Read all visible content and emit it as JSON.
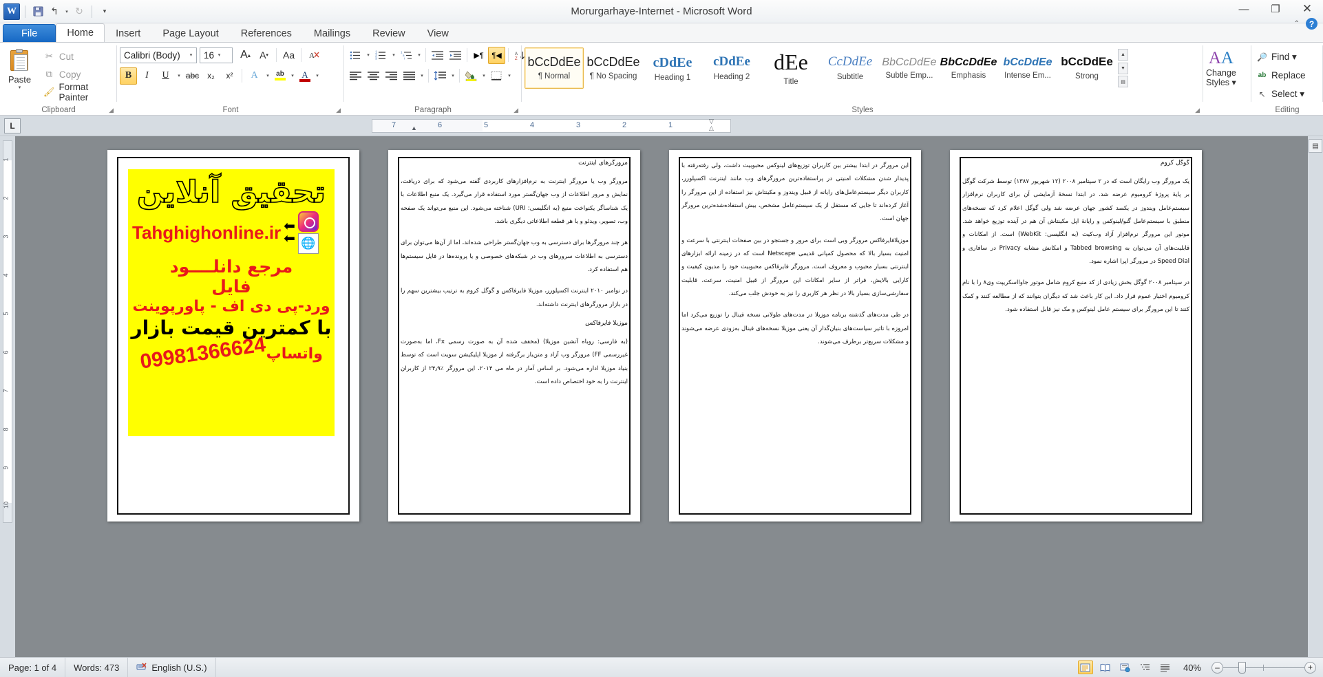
{
  "window": {
    "title": "Morurgarhaye-Internet  -  Microsoft Word",
    "minimize": "—",
    "restore": "❐",
    "close": "✕",
    "help": "?",
    "collapse_ribbon": "⌃"
  },
  "qat": {
    "logo": "W",
    "save": "save-icon",
    "undo": "↰",
    "redo": "↻",
    "customize": "▾"
  },
  "tabs": [
    {
      "label": "File",
      "active": false,
      "file": true
    },
    {
      "label": "Home",
      "active": true
    },
    {
      "label": "Insert",
      "active": false
    },
    {
      "label": "Page Layout",
      "active": false
    },
    {
      "label": "References",
      "active": false
    },
    {
      "label": "Mailings",
      "active": false
    },
    {
      "label": "Review",
      "active": false
    },
    {
      "label": "View",
      "active": false
    }
  ],
  "ribbon": {
    "clipboard": {
      "group_label": "Clipboard",
      "paste": "Paste",
      "paste_arrow": "▾",
      "items": [
        {
          "label": "Cut",
          "icon": "scissors-icon",
          "glyph": "✂",
          "enabled": false
        },
        {
          "label": "Copy",
          "icon": "copy-icon",
          "glyph": "⧉",
          "enabled": false
        },
        {
          "label": "Format Painter",
          "icon": "brush-icon",
          "glyph": "🖌",
          "enabled": true
        }
      ]
    },
    "font": {
      "group_label": "Font",
      "font_name": "Calibri (Body)",
      "font_size": "16",
      "grow_font": "A",
      "shrink_font": "A",
      "change_case": "Aa",
      "clear_formatting": "⌫",
      "bold": "B",
      "bold_active": true,
      "italic": "I",
      "underline": "U",
      "strikethrough": "abc",
      "subscript": "x₂",
      "superscript": "x²",
      "text_effects": "A",
      "highlight": "ab",
      "font_color": "A",
      "highlight_color": "#ffff00",
      "font_color_value": "#c00000"
    },
    "paragraph": {
      "group_label": "Paragraph",
      "bullets": "≔",
      "numbering": "≕",
      "multilevel": "≖",
      "decrease_indent": "⇤",
      "increase_indent": "⇥",
      "ltr_text": "▶¶",
      "rtl_text": "¶◀",
      "rtl_active": true,
      "sort": "A↓",
      "show_marks": "¶",
      "align_left": "≡",
      "align_center": "≡",
      "align_right": "≡",
      "justify": "≡",
      "line_spacing": "↕≡",
      "shading": "▱",
      "borders": "⊞"
    },
    "styles": {
      "group_label": "Styles",
      "items": [
        {
          "preview": "bCcDdEe",
          "name": "¶ Normal",
          "selected": true,
          "style": "normal"
        },
        {
          "preview": "bCcDdEe",
          "name": "¶ No Spacing",
          "selected": false,
          "style": "normal"
        },
        {
          "preview": "cDdEe",
          "name": "Heading 1",
          "selected": false,
          "style": "h1"
        },
        {
          "preview": "cDdEe",
          "name": "Heading 2",
          "selected": false,
          "style": "h2"
        },
        {
          "preview": "dEe",
          "name": "Title",
          "selected": false,
          "style": "title"
        },
        {
          "preview": "CcDdEe",
          "name": "Subtitle",
          "selected": false,
          "style": "subtitle"
        },
        {
          "preview": "BbCcDdEe",
          "name": "Subtle Emp...",
          "selected": false,
          "style": "subtle"
        },
        {
          "preview": "BbCcDdEe",
          "name": "Emphasis",
          "selected": false,
          "style": "emphasis"
        },
        {
          "preview": "bCcDdEe",
          "name": "Intense Em...",
          "selected": false,
          "style": "intense"
        },
        {
          "preview": "bCcDdEe",
          "name": "Strong",
          "selected": false,
          "style": "strong"
        }
      ],
      "scroll_up": "▲",
      "scroll_down": "▼",
      "more": "▤"
    },
    "change_styles": {
      "group_label": "",
      "icon": "AA",
      "label_line1": "Change",
      "label_line2": "Styles ▾"
    },
    "editing": {
      "group_label": "Editing",
      "items": [
        {
          "label": "Find ▾",
          "icon": "binoculars-icon",
          "glyph": "🔍"
        },
        {
          "label": "Replace",
          "icon": "replace-icon",
          "glyph": "ab"
        },
        {
          "label": "Select ▾",
          "icon": "pointer-icon",
          "glyph": "↖"
        }
      ]
    }
  },
  "ruler": {
    "tab_selector": "L",
    "h_numbers": [
      "7",
      "6",
      "5",
      "4",
      "3",
      "2",
      "1"
    ],
    "v_numbers": [
      "1",
      "2",
      "3",
      "4",
      "5",
      "6",
      "7",
      "8",
      "9",
      "10"
    ]
  },
  "document": {
    "pages": [
      {
        "kind": "ad",
        "ad": {
          "title": "تحقیق آنلاین",
          "url": "Tahghighonline.ir",
          "arrow": "⬅",
          "instagram_icon": "instagram-icon",
          "globe_icon": "globe-icon",
          "line1": "مرجع دانلــــود",
          "line2": "فایل",
          "line3": "ورد-پی دی اف - پاورپوینت",
          "line4": "با کمترین قیمت بازار",
          "phone": "09981366624",
          "whatsapp": "واتساپ"
        }
      },
      {
        "kind": "text",
        "heading": "مرورگرهای اینترنت",
        "paragraphs": [
          "مرورگر وب یا مرورگر اینترنت به نرم‌افزارهای کاربردی گفته می‌شود که برای دریافت، نمایش و مرور اطلاعات از وب جهان‌گستر مورد استفاده قرار می‌گیرد. یک منبع اطلاعات با یک شناساگر یکنواخت منبع (به انگلیسی: URI) شناخته می‌شود. این منبع می‌تواند یک صفحه وب، تصویر، ویدئو و یا هر قطعه اطلاعاتی دیگری باشد.",
          "هر چند مرورگرها برای دسترسی به وب جهان‌گستر طراحی شده‌اند، اما از آن‌ها می‌توان برای دسترسی به اطلاعات سرورهای وب در شبکه‌های خصوصی و یا پرونده‌ها در فایل سیستم‌ها هم استفاده کرد.",
          "در نوامبر ۲۰۱۰ اینترنت اکسپلورر، موزیلا فایرفاکس و گوگل کروم به ترتیب بیشترین سهم را در بازار مرورگرهای اینترنت داشته‌اند."
        ],
        "subheading": "موزیلا فایرفاکس",
        "paragraphs2": [
          "(به فارسی: روباه آتشین موزیلا) (مخفف شده آن به صورت رسمی Fx، اما به‌صورت غیررسمی FF) مرورگر وب آزاد و متن‌باز برگرفته از موزیلا اپلیکیشن سویت است که توسط بنیاد موزیلا اداره می‌شود. بر اساس آمار در ماه می ۲۰۱۴، این مرورگر ٪۲۴٫۹ از کاربران اینترنت را به خود اختصاص داده است."
        ]
      },
      {
        "kind": "text",
        "heading": "",
        "paragraphs": [
          "این مرورگر در ابتدا بیشتر بین کاربران توزیع‌های لینوکس محبوبیت داشت، ولی رفته‌رفته با پدیدار شدن مشکلات امنیتی در پراستفاده‌ترین مرورگرهای وب مانند اینترنت اکسپلورر، کاربران دیگر سیستم‌عامل‌های رایانه از قبیل ویندوز و مکینتاش نیز استفاده از این مرورگر را آغاز کرده‌اند تا جایی که مستقل از یک سیستم‌عامل مشخص، بیش استفاده‌شده‌ترین مرورگر جهان است.",
          "موزیلافایرفاکس مرورگر وبی است برای مرور و جستجو در بین صفحات اینترنتی با سرعت و امنیت بسیار بالا که محصول کمپانی قدیمی Netscape است که در زمینه ارائه ابزارهای اینترنتی بسیار محبوب و معروف است. مرورگر فایرفاکس محبوبیت خود را مدیون کیفیت و کارایی بالایش، فراتر از سایر امکانات این مرورگر از قبیل امنیت، سرعت، قابلیت سفارشی‌سازی بسیار بالا در نظر هر کاربری را نیز به خودش جلب می‌کند.",
          "در طی مدت‌های گذشته برنامه موزیلا در مدت‌های طولانی نسخه فینال را توزیع می‌کرد اما امروزه با تاثیر سیاست‌های بنیان‌گذار آن یعنی موزیلا نسخه‌های فینال به‌زودی عرضه می‌شوند و مشکلات سریع‌تر برطرف می‌شوند."
        ],
        "subheading": "",
        "paragraphs2": []
      },
      {
        "kind": "text",
        "heading": "گوگل کروم",
        "paragraphs": [
          "یک مرورگر وب رایگان است که در ۲ سپتامبر ۲۰۰۸ (۱۲ شهریور ۱۳۸۷) توسط شرکت گوگل بر پایهٔ پروژهٔ کرومیوم عرضه شد. در ابتدا نسخهٔ آزمایشی آن برای کاربران نرم‌افزار سیستم‌عامل ویندوز در یکصد کشور جهان عرضه شد ولی گوگل اعلام کرد که نسخه‌های منطبق با سیستم‌عامل گنو/لینوکس و رایانهٔ اپل مکینتاش آن هم در آینده توزیع خواهد شد. موتور این مرورگر نرم‌افزار آزاد وب‌کیت (به انگلیسی: WebKit) است. از امکانات و قابلیت‌های آن می‌توان به Tabbed browsing و امکانش مشابه Privacy در سافاری و Speed Dial در مرورگر اپرا اشاره نمود.",
          "در سپتامبر ۲۰۰۸ گوگل بخش زیادی از کد منبع کروم شامل موتور جاوااسکریپت وی‌۸ را با نام کرومیوم اختیار عموم قرار داد. این کار باعث شد که دیگران بتوانند که از مطالعه کنند و کمک کنند تا این مرورگر برای سیستم عامل لینوکس و مک نیز قابل استفاده شود."
        ],
        "subheading": "",
        "paragraphs2": []
      }
    ]
  },
  "status": {
    "page": "Page: 1 of 4",
    "words": "Words: 473",
    "spell_icon": "spellcheck-icon",
    "language": "English (U.S.)",
    "views": [
      {
        "name": "print-layout",
        "glyph": "▤",
        "active": true
      },
      {
        "name": "full-screen-reading",
        "glyph": "▥",
        "active": false
      },
      {
        "name": "web-layout",
        "glyph": "▦",
        "active": false
      },
      {
        "name": "outline",
        "glyph": "▧",
        "active": false
      },
      {
        "name": "draft",
        "glyph": "▤",
        "active": false
      }
    ],
    "zoom": "40%",
    "zoom_out": "–",
    "zoom_in": "+"
  }
}
